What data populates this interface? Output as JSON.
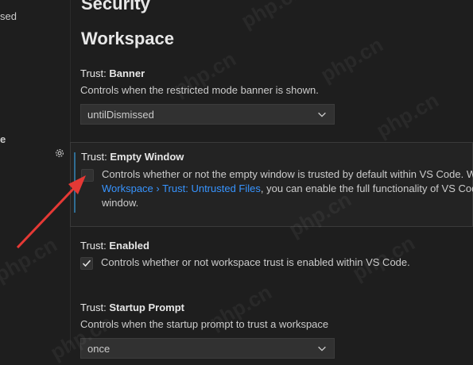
{
  "sidebar": {
    "fragment_top": "sed",
    "fragment_mid": "e"
  },
  "headings": {
    "security": "Security",
    "workspace": "Workspace"
  },
  "settings": {
    "banner": {
      "category": "Trust: ",
      "name": "Banner",
      "description": "Controls when the restricted mode banner is shown.",
      "value": "untilDismissed"
    },
    "empty_window": {
      "category": "Trust: ",
      "name": "Empty Window",
      "description_line1": "Controls whether or not the empty window is trusted by default within VS Code. W",
      "link_text": "Workspace › Trust: Untrusted Files",
      "description_line2_rest": ", you can enable the full functionality of VS Code",
      "description_line3": "window.",
      "checked": false
    },
    "enabled": {
      "category": "Trust: ",
      "name": "Enabled",
      "description": "Controls whether or not workspace trust is enabled within VS Code.",
      "checked": true
    },
    "startup_prompt": {
      "category": "Trust: ",
      "name": "Startup Prompt",
      "description": "Controls when the startup prompt to trust a workspace",
      "value": "once"
    }
  },
  "watermark": "php.cn",
  "colors": {
    "background": "#1e1e1e",
    "link": "#3794ff",
    "focus_bar": "#2f6d93",
    "arrow": "#e53935"
  },
  "icons": {
    "gear": "gear-icon",
    "chevron": "chevron-down-icon",
    "check": "check-icon"
  }
}
